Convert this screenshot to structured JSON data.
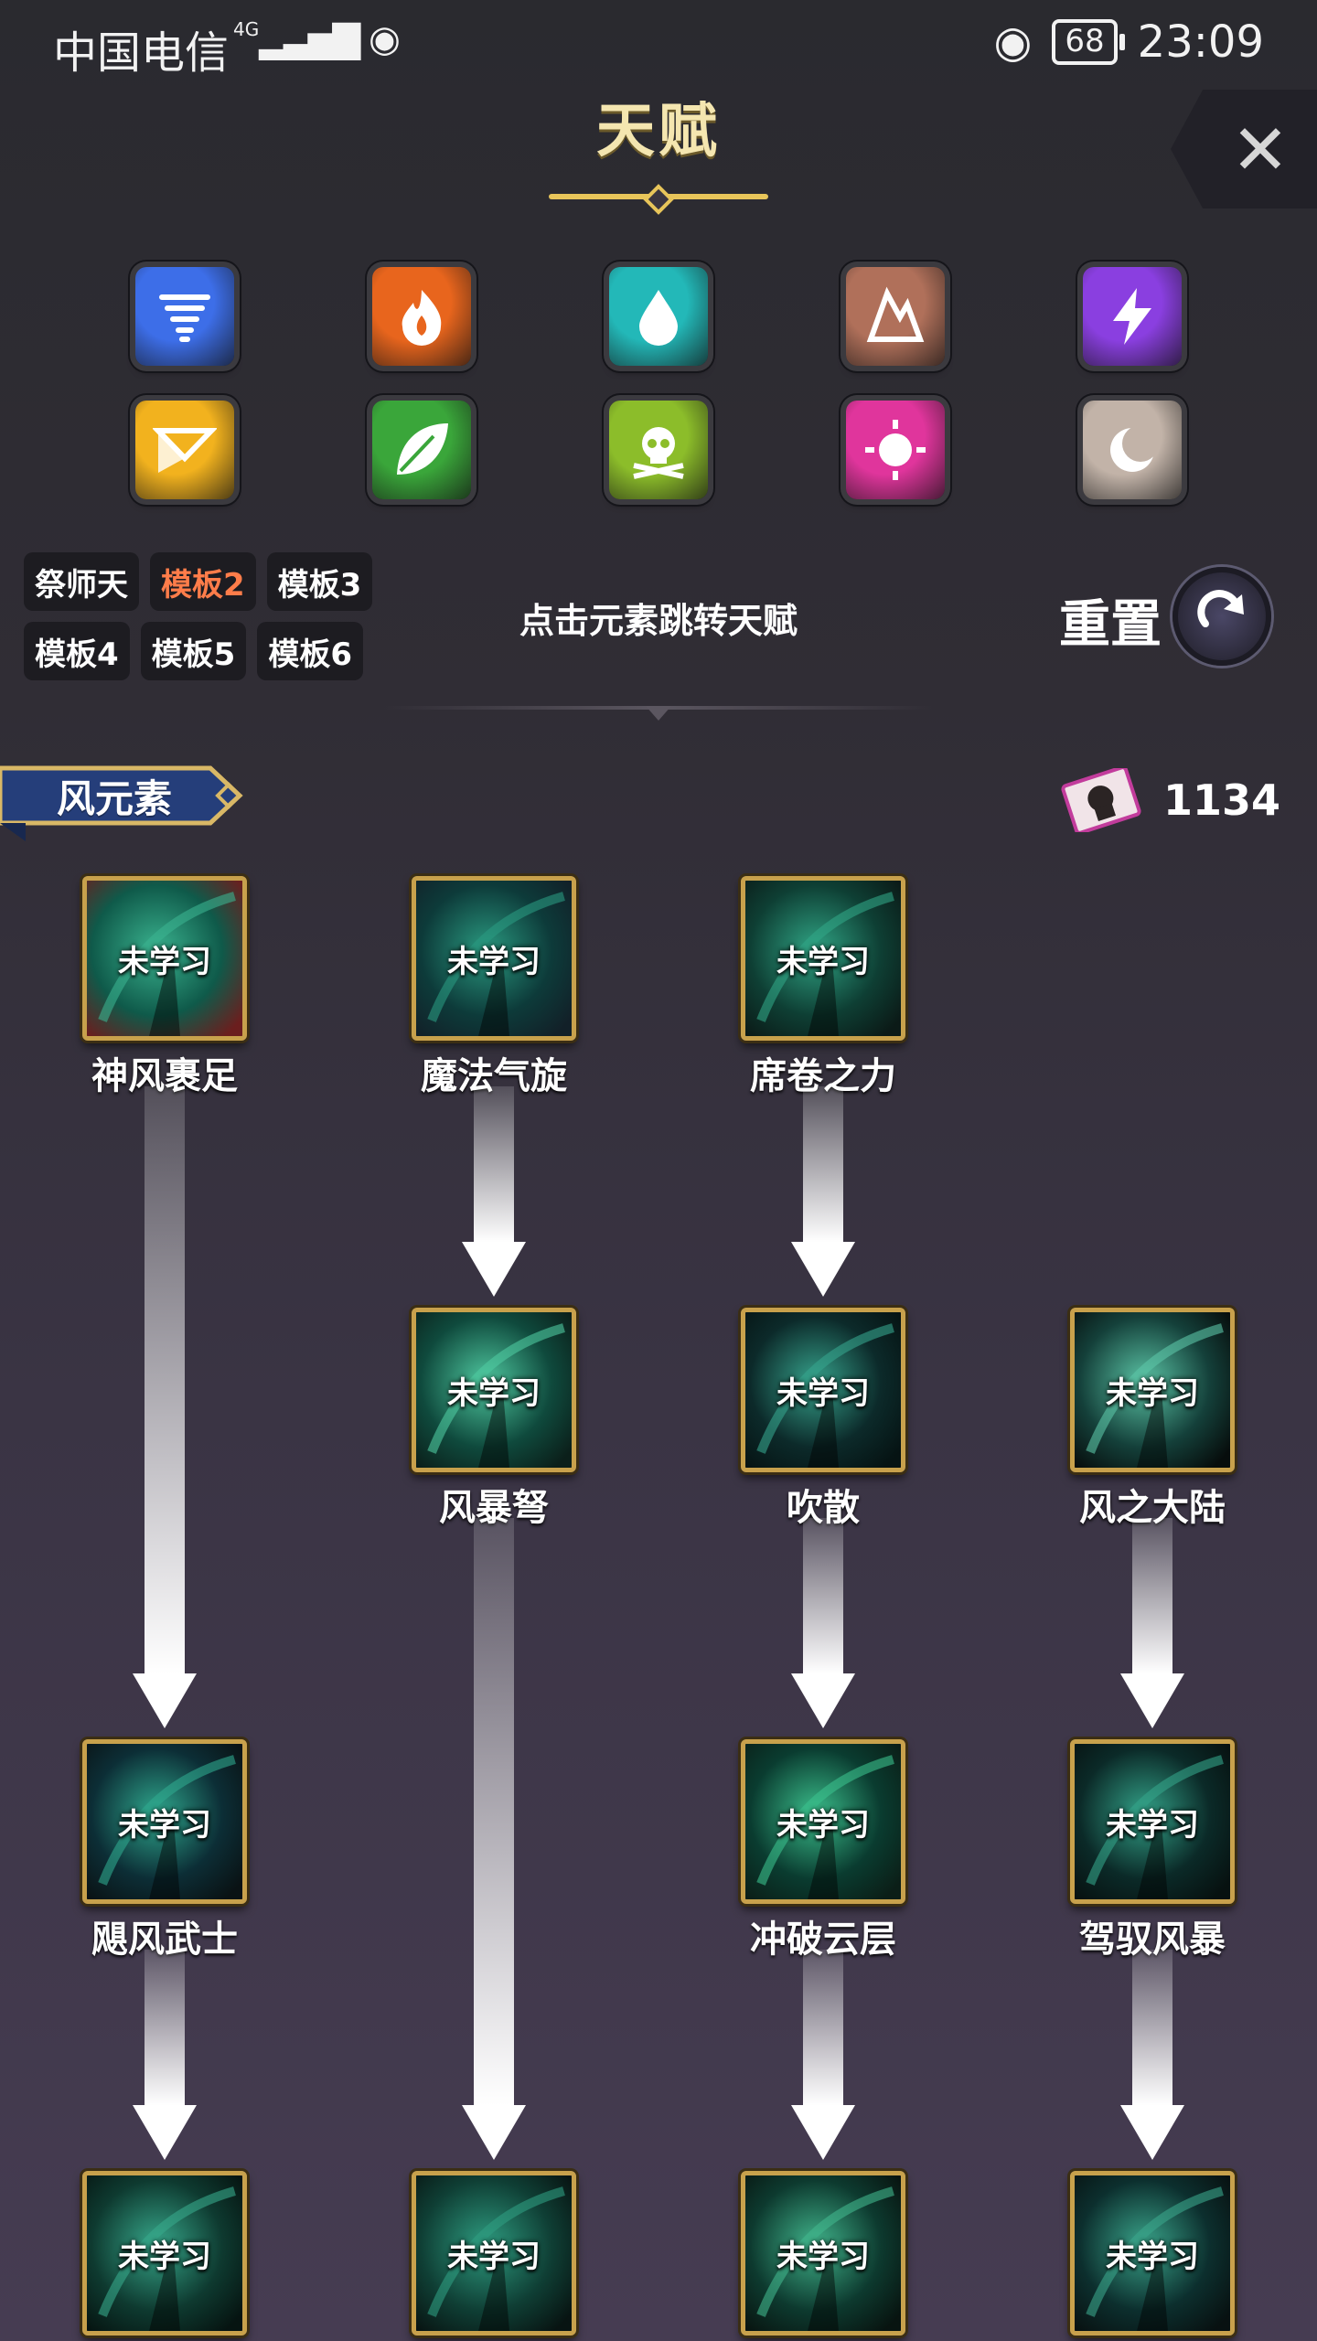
{
  "status_bar": {
    "carrier": "中国电信",
    "network": "4G",
    "battery": "68",
    "time": "23:09"
  },
  "header": {
    "title": "天赋"
  },
  "elements": [
    {
      "icon": "tornado-icon",
      "color": "#3d6ee8"
    },
    {
      "icon": "fire-icon",
      "color": "#e8651d"
    },
    {
      "icon": "water-drop-icon",
      "color": "#23b8b8"
    },
    {
      "icon": "earth-icon",
      "color": "#b0705a"
    },
    {
      "icon": "lightning-icon",
      "color": "#8a3fe0"
    },
    {
      "icon": "light-icon",
      "color": "#f2b21e"
    },
    {
      "icon": "leaf-icon",
      "color": "#3aa63a"
    },
    {
      "icon": "skull-icon",
      "color": "#8cbd2a"
    },
    {
      "icon": "sun-icon",
      "color": "#e0359c"
    },
    {
      "icon": "moon-icon",
      "color": "#c2b3a8"
    }
  ],
  "templates": {
    "row1": [
      "祭师天",
      "模板2",
      "模板3"
    ],
    "row2": [
      "模板4",
      "模板5",
      "模板6"
    ],
    "active": "模板2"
  },
  "hint": "点击元素跳转天赋",
  "reset_label": "重置",
  "element_banner": "风元素",
  "talent_points": "1134",
  "nodes": [
    {
      "name": "神风裹足",
      "status": "未学习"
    },
    {
      "name": "魔法气旋",
      "status": "未学习"
    },
    {
      "name": "席卷之力",
      "status": "未学习"
    },
    {
      "name": "风暴弩",
      "status": "未学习"
    },
    {
      "name": "吹散",
      "status": "未学习"
    },
    {
      "name": "风之大陆",
      "status": "未学习"
    },
    {
      "name": "飓风武士",
      "status": "未学习"
    },
    {
      "name": "冲破云层",
      "status": "未学习"
    },
    {
      "name": "驾驭风暴",
      "status": "未学习"
    },
    {
      "name": "",
      "status": "未学习"
    },
    {
      "name": "",
      "status": "未学习"
    },
    {
      "name": "",
      "status": "未学习"
    },
    {
      "name": "",
      "status": "未学习"
    }
  ]
}
